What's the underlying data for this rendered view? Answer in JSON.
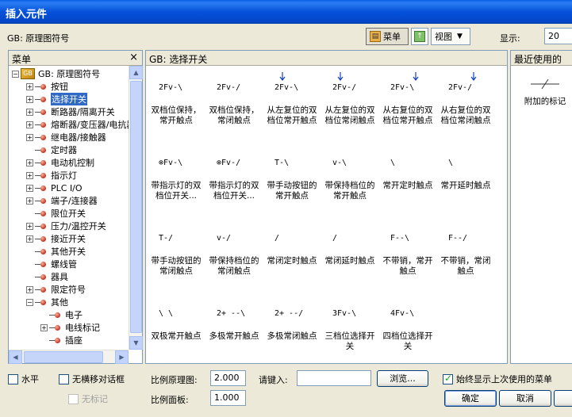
{
  "window": {
    "title": "插入元件"
  },
  "toolbar": {
    "library_label": "GB: 原理图符号",
    "menu_button": "菜单",
    "view_button": "视图",
    "display_label": "显示:",
    "display_value": "20"
  },
  "tree_panel": {
    "title": "菜单",
    "close": "×",
    "root": "GB: 原理图符号",
    "items": [
      {
        "label": "按钮",
        "expander": "+"
      },
      {
        "label": "选择开关",
        "expander": "+",
        "selected": true
      },
      {
        "label": "断路器/隔离开关",
        "expander": "+"
      },
      {
        "label": "熔断器/变压器/电抗器",
        "expander": "+"
      },
      {
        "label": "继电器/接触器",
        "expander": "+"
      },
      {
        "label": "定时器",
        "expander": ""
      },
      {
        "label": "电动机控制",
        "expander": "+"
      },
      {
        "label": "指示灯",
        "expander": "+"
      },
      {
        "label": "PLC I/O",
        "expander": "+"
      },
      {
        "label": "端子/连接器",
        "expander": "+"
      },
      {
        "label": "限位开关",
        "expander": ""
      },
      {
        "label": "压力/温控开关",
        "expander": "+"
      },
      {
        "label": "接近开关",
        "expander": "+"
      },
      {
        "label": "其他开关",
        "expander": ""
      },
      {
        "label": "螺线管",
        "expander": ""
      },
      {
        "label": "器具",
        "expander": ""
      },
      {
        "label": "限定符号",
        "expander": "+"
      },
      {
        "label": "其他",
        "expander": "−"
      }
    ],
    "sub_items": [
      {
        "label": "电子",
        "expander": ""
      },
      {
        "label": "电线标记",
        "expander": "+"
      },
      {
        "label": "插座",
        "expander": ""
      },
      {
        "label": "…",
        "expander": ""
      }
    ]
  },
  "symbols_panel": {
    "title": "GB: 选择开关",
    "symbols": [
      {
        "label": "双档位保持，常开触点",
        "glyph": "2Fv-\\",
        "mark": ""
      },
      {
        "label": "双档位保持，常闭触点",
        "glyph": "2Fv-/",
        "mark": ""
      },
      {
        "label": "从左复位的双档位常开触点",
        "glyph": "2Fv-\\",
        "mark": "arrow-left"
      },
      {
        "label": "从左复位的双档位常闭触点",
        "glyph": "2Fv-/",
        "mark": "arrow-left"
      },
      {
        "label": "从右复位的双档位常开触点",
        "glyph": "2Fv-\\",
        "mark": "arrow-right"
      },
      {
        "label": "从右复位的双档位常闭触点",
        "glyph": "2Fv-/",
        "mark": "arrow-right"
      },
      {
        "label": "带指示灯的双档位开关...",
        "glyph": "⊗Fv-\\",
        "mark": ""
      },
      {
        "label": "带指示灯的双档位开关...",
        "glyph": "⊗Fv-/",
        "mark": ""
      },
      {
        "label": "带手动按钮的常开触点",
        "glyph": "T-\\",
        "mark": ""
      },
      {
        "label": "带保持档位的常开触点",
        "glyph": "v-\\",
        "mark": ""
      },
      {
        "label": "常开定时触点",
        "glyph": "\\",
        "mark": ""
      },
      {
        "label": "常开延时触点",
        "glyph": "\\",
        "mark": ""
      },
      {
        "label": "带手动按钮的常闭触点",
        "glyph": "T-/",
        "mark": ""
      },
      {
        "label": "带保持档位的常闭触点",
        "glyph": "v-/",
        "mark": ""
      },
      {
        "label": "常闭定时触点",
        "glyph": "/",
        "mark": ""
      },
      {
        "label": "常闭延时触点",
        "glyph": "/",
        "mark": ""
      },
      {
        "label": "不带销，常开触点",
        "glyph": "F--\\",
        "mark": ""
      },
      {
        "label": "不带销，常闭触点",
        "glyph": "F--/",
        "mark": ""
      },
      {
        "label": "双极常开触点",
        "glyph": "\\ \\",
        "mark": ""
      },
      {
        "label": "多极常开触点",
        "glyph": "2+ --\\",
        "mark": ""
      },
      {
        "label": "多极常闭触点",
        "glyph": "2+ --/",
        "mark": ""
      },
      {
        "label": "三档位选择开关",
        "glyph": "3Fv-\\",
        "mark": ""
      },
      {
        "label": "四档位选择开关",
        "glyph": "4Fv-\\",
        "mark": ""
      }
    ]
  },
  "recent_panel": {
    "title": "最近使用的",
    "items": [
      {
        "label": "附加的标记"
      }
    ]
  },
  "bottom": {
    "horizontal_label": "水平",
    "no_dialog_label": "无横移对话框",
    "no_tag_label": "无标记",
    "scale_schematic_label": "比例原理图:",
    "scale_schematic_value": "2.000",
    "scale_panel_label": "比例面板:",
    "scale_panel_value": "1.000",
    "type_label": "请键入:",
    "type_value": "",
    "browse_button": "浏览...",
    "show_recent_label": "始终显示上次使用的菜单",
    "ok_button": "确定",
    "cancel_button": "取消"
  }
}
